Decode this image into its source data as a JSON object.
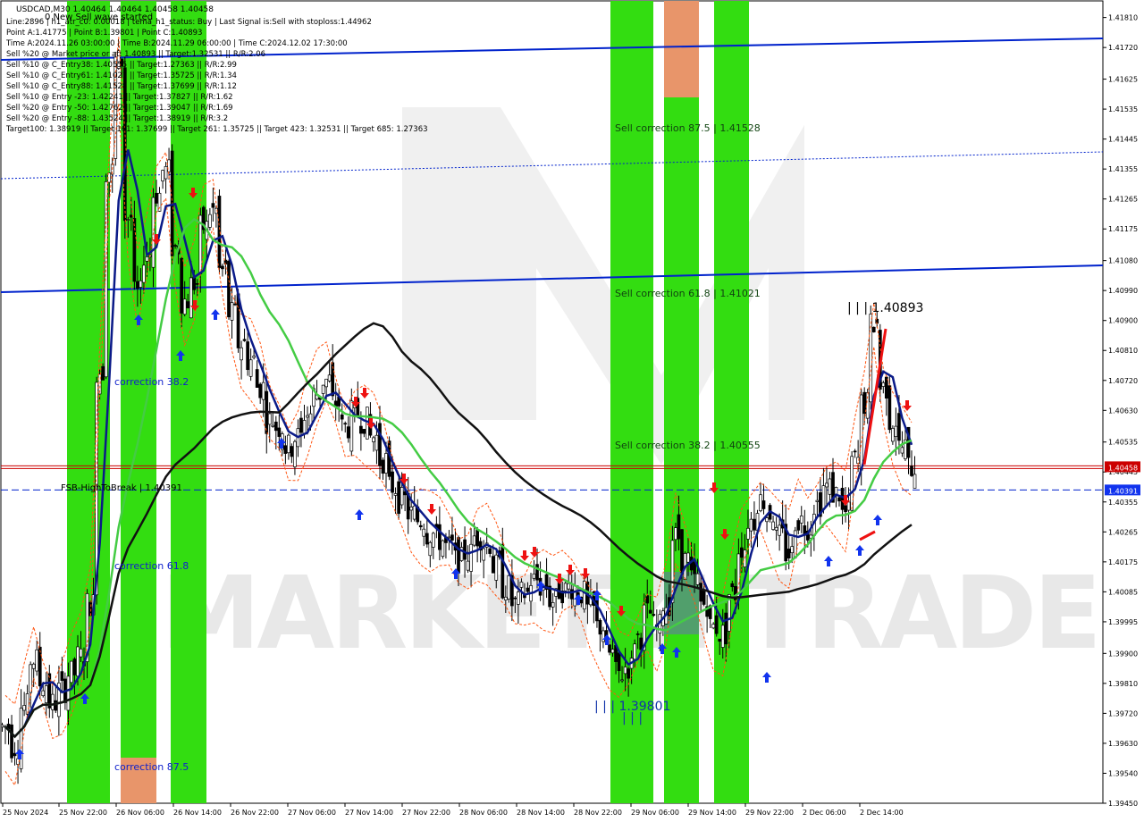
{
  "header": {
    "symbol_line": "USDCAD,M30  1.40464 1.40464 1.40458 1.40458",
    "wave_status": "0 New Sell wave started",
    "info_lines": [
      "Line:2896 | h1_atr_c0: 0.00018 | tema_h1_status: Buy | Last Signal is:Sell with stoploss:1.44962",
      "Point A:1.41775 | Point B:1.39801 | Point C:1.40893",
      "Time A:2024.11.26 03:00:00 | Time B:2024.11.29 06:00:00 | Time C:2024.12.02 17:30:00",
      "Sell %20 @ Market price or at: 1.40893 || Target:1.32531 || R/R:2.06",
      "Sell %10 @ C_Entry38: 1.40555 || Target:1.27363 || R/R:2.99",
      "Sell %10 @ C_Entry61: 1.41021 || Target:1.35725 || R/R:1.34",
      "Sell %10 @ C_Entry88: 1.41528 || Target:1.37699 || R/R:1.12",
      "Sell %10 @ Entry -23: 1.42241 || Target:1.37827 || R/R:1.62",
      "Sell %20 @ Entry -50: 1.42762 || Target:1.39047 || R/R:1.69",
      "Sell %20 @ Entry -88: 1.43524 || Target:1.38919 || R/R:3.2",
      "Target100: 1.38919 || Target 161: 1.37699 || Target 261: 1.35725 || Target 423: 1.32531 || Target 685: 1.27363"
    ]
  },
  "annotations": {
    "sell_corr_875": "Sell correction 87.5 | 1.41528",
    "sell_corr_618": "Sell correction 61.8 | 1.41021",
    "sell_corr_382": "Sell correction 38.2 | 1.40555",
    "corr_382": "correction 38.2",
    "corr_618": "correction 61.8",
    "corr_875": "correction 87.5",
    "fsb_label": "FSB-HighToBreak | 1.40391",
    "point_c_label": "| | | 1.40893",
    "point_b_label": "| | | 1.39801",
    "point_b_ticks": "| | |",
    "watermark": "MARKETZI TRADE"
  },
  "colors": {
    "background": "#ffffff",
    "green_zone": "#33dd11",
    "orange_zone": "#e8956a",
    "blue_line": "#0022cc",
    "navy_ma": "#0a1a88",
    "green_ma": "#44cc44",
    "black_ma": "#111111",
    "price_line": "#cc0000",
    "fsb_line": "#0022cc",
    "orange_dash": "#ff5511",
    "buy_arrow": "#1133ee",
    "sell_arrow": "#ee1111"
  },
  "chart_data": {
    "type": "candlestick",
    "symbol": "USDCAD",
    "timeframe": "M30",
    "ylim": [
      1.3945,
      1.4186
    ],
    "price_ticks": [
      "1.41810",
      "1.41720",
      "1.41625",
      "1.41535",
      "1.41445",
      "1.41355",
      "1.41265",
      "1.41175",
      "1.41080",
      "1.40990",
      "1.40900",
      "1.40810",
      "1.40720",
      "1.40630",
      "1.40535",
      "1.40445",
      "1.40355",
      "1.40265",
      "1.40175",
      "1.40085",
      "1.39995",
      "1.39900",
      "1.39810",
      "1.39720",
      "1.39630",
      "1.39540",
      "1.39450"
    ],
    "x_ticks": [
      "25 Nov 2024",
      "25 Nov 22:00",
      "26 Nov 06:00",
      "26 Nov 14:00",
      "26 Nov 22:00",
      "27 Nov 06:00",
      "27 Nov 14:00",
      "27 Nov 22:00",
      "28 Nov 06:00",
      "28 Nov 14:00",
      "28 Nov 22:00",
      "29 Nov 06:00",
      "29 Nov 14:00",
      "29 Nov 22:00",
      "2 Dec 06:00",
      "2 Dec 14:00"
    ],
    "current_price": "1.40458",
    "fsb_price": "1.40391",
    "levels": {
      "sell_correction_87_5": 1.41528,
      "sell_correction_61_8": 1.41021,
      "sell_correction_38_2": 1.40555,
      "point_a": 1.41775,
      "point_b": 1.39801,
      "point_c": 1.40893
    },
    "close_series": [
      1.3968,
      1.3962,
      1.3974,
      1.3988,
      1.3981,
      1.3975,
      1.3979,
      1.3984,
      1.3989,
      1.4005,
      1.4075,
      1.4135,
      1.4168,
      1.4121,
      1.4098,
      1.411,
      1.4128,
      1.4135,
      1.4112,
      1.4096,
      1.4101,
      1.4118,
      1.4123,
      1.4105,
      1.4092,
      1.4083,
      1.4078,
      1.407,
      1.406,
      1.4058,
      1.4052,
      1.4055,
      1.4062,
      1.4068,
      1.4072,
      1.4065,
      1.4058,
      1.4062,
      1.406,
      1.4055,
      1.4048,
      1.404,
      1.4036,
      1.4032,
      1.403,
      1.4026,
      1.4024,
      1.4022,
      1.4018,
      1.402,
      1.4025,
      1.4023,
      1.4016,
      1.401,
      1.4005,
      1.4008,
      1.4012,
      1.401,
      1.4006,
      1.4009,
      1.401,
      1.4008,
      1.4003,
      1.3998,
      1.399,
      1.3984,
      1.3986,
      1.3995,
      1.4002,
      1.3998,
      1.4005,
      1.4025,
      1.4018,
      1.4012,
      1.4005,
      1.3998,
      1.3996,
      1.4008,
      1.4022,
      1.403,
      1.4036,
      1.4032,
      1.4025,
      1.402,
      1.403,
      1.4028,
      1.4035,
      1.404,
      1.4038,
      1.4032,
      1.4048,
      1.4065,
      1.4089,
      1.407,
      1.406,
      1.4052,
      1.4046
    ]
  }
}
